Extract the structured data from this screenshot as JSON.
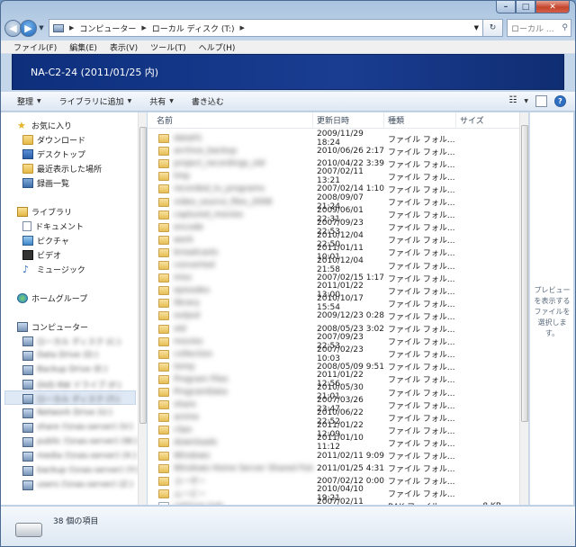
{
  "window": {
    "min_glyph": "–",
    "max_glyph": "□",
    "close_glyph": "✕"
  },
  "address": {
    "crumbs": [
      "コンピューター",
      "ローカル ディスク (T:)"
    ],
    "search_placeholder": "ローカル ..."
  },
  "menu": [
    "ファイル(F)",
    "編集(E)",
    "表示(V)",
    "ツール(T)",
    "ヘルプ(H)"
  ],
  "banner": {
    "title": "NA-C2-24 (2011/01/25 内)"
  },
  "commands": [
    "整理",
    "ライブラリに追加",
    "共有",
    "書き込む"
  ],
  "nav": {
    "favorites": {
      "label": "お気に入り",
      "items": [
        "ダウンロード",
        "デスクトップ",
        "最近表示した場所",
        "録画一覧"
      ]
    },
    "libraries": {
      "label": "ライブラリ",
      "items": [
        "ドキュメント",
        "ピクチャ",
        "ビデオ",
        "ミュージック"
      ]
    },
    "homegroup": "ホームグループ",
    "computer": {
      "label": "コンピューター",
      "drives": [
        "ローカル ディスク (C:)",
        "Data Drive (D:)",
        "Backup Drive (E:)",
        "DVD RW ドライブ (F:)",
        "ローカル ディスク (T:)",
        "Network Drive (U:)",
        "share (\\\\nas-server) (V:)",
        "public (\\\\nas-server) (W:)",
        "media (\\\\nas-server) (X:)",
        "backup (\\\\nas-server) (Y:)",
        "users (\\\\nas-server) (Z:)"
      ]
    }
  },
  "columns": {
    "name": "名前",
    "date": "更新日時",
    "type": "種類",
    "size": "サイズ"
  },
  "files": [
    {
      "name": "data01",
      "date": "2009/11/29 18:24",
      "type": "ファイル フォル...",
      "size": ""
    },
    {
      "name": "archive_backup",
      "date": "2010/06/26 2:17",
      "type": "ファイル フォル...",
      "size": ""
    },
    {
      "name": "project_recordings_old",
      "date": "2010/04/22 3:39",
      "type": "ファイル フォル...",
      "size": ""
    },
    {
      "name": "tmp",
      "date": "2007/02/11 13:21",
      "type": "ファイル フォル...",
      "size": ""
    },
    {
      "name": "recorded_tv_programs",
      "date": "2007/02/14 1:10",
      "type": "ファイル フォル...",
      "size": ""
    },
    {
      "name": "video_source_files_2008",
      "date": "2008/09/07 21:24",
      "type": "ファイル フォル...",
      "size": ""
    },
    {
      "name": "captured_movies",
      "date": "2009/06/01 22:31",
      "type": "ファイル フォル...",
      "size": ""
    },
    {
      "name": "encode",
      "date": "2007/09/23 22:53",
      "type": "ファイル フォル...",
      "size": ""
    },
    {
      "name": "work",
      "date": "2010/12/04 22:50",
      "type": "ファイル フォル...",
      "size": ""
    },
    {
      "name": "broadcasts",
      "date": "2011/01/11 10:01",
      "type": "ファイル フォル...",
      "size": ""
    },
    {
      "name": "converted",
      "date": "2010/12/04 21:58",
      "type": "ファイル フォル...",
      "size": ""
    },
    {
      "name": "misc",
      "date": "2007/02/15 1:17",
      "type": "ファイル フォル...",
      "size": ""
    },
    {
      "name": "episodes",
      "date": "2011/01/22 13:00",
      "type": "ファイル フォル...",
      "size": ""
    },
    {
      "name": "library",
      "date": "2010/10/17 15:54",
      "type": "ファイル フォル...",
      "size": ""
    },
    {
      "name": "output",
      "date": "2009/12/23 0:28",
      "type": "ファイル フォル...",
      "size": ""
    },
    {
      "name": "old",
      "date": "2008/05/23 3:02",
      "type": "ファイル フォル...",
      "size": ""
    },
    {
      "name": "movies",
      "date": "2007/09/23 22:53",
      "type": "ファイル フォル...",
      "size": ""
    },
    {
      "name": "collection",
      "date": "2007/02/23 10:03",
      "type": "ファイル フォル...",
      "size": ""
    },
    {
      "name": "temp",
      "date": "2008/05/09 9:51",
      "type": "ファイル フォル...",
      "size": ""
    },
    {
      "name": "Program Files",
      "date": "2011/01/22 12:56",
      "type": "ファイル フォル...",
      "size": ""
    },
    {
      "name": "ProgramData",
      "date": "2010/05/30 21:01",
      "type": "ファイル フォル...",
      "size": ""
    },
    {
      "name": "share",
      "date": "2007/03/26 23:47",
      "type": "ファイル フォル...",
      "size": ""
    },
    {
      "name": "anime",
      "date": "2010/06/22 22:52",
      "type": "ファイル フォル...",
      "size": ""
    },
    {
      "name": "clips",
      "date": "2011/01/22 12:09",
      "type": "ファイル フォル...",
      "size": ""
    },
    {
      "name": "downloads",
      "date": "2011/01/10 11:12",
      "type": "ファイル フォル...",
      "size": ""
    },
    {
      "name": "Windows",
      "date": "2011/02/11 9:09",
      "type": "ファイル フォル...",
      "size": ""
    },
    {
      "name": "Windows Home Server Shared Folders",
      "date": "2011/01/25 4:31",
      "type": "ファイル フォル...",
      "size": ""
    },
    {
      "name": "ユーザー",
      "date": "2007/02/12 0:00",
      "type": "ファイル フォル...",
      "size": ""
    },
    {
      "name": "ムービー",
      "date": "2010/04/10 19:21",
      "type": "ファイル フォル...",
      "size": ""
    },
    {
      "name": "settings.bak",
      "date": "2007/02/11 12:57",
      "type": "BAK ファイル",
      "size": "8 KB",
      "bak": true
    }
  ],
  "preview": {
    "text": "プレビューを表示するファイルを選択します。"
  },
  "status": {
    "count": "38 個の項目"
  }
}
